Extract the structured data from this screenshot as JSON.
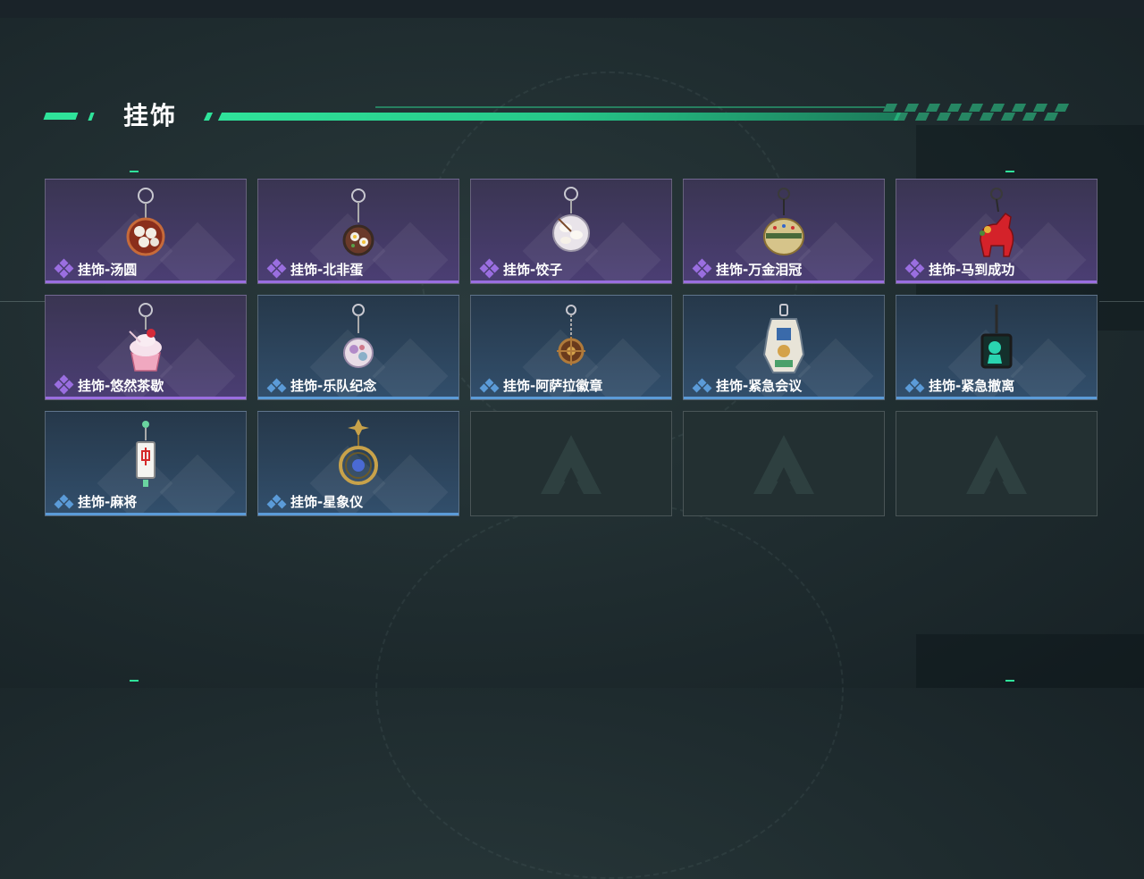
{
  "section": {
    "title": "挂饰"
  },
  "colors": {
    "accent_green": "#2fe39a",
    "rarity_purple": "#9a6ee0",
    "rarity_blue": "#5b9bd8"
  },
  "items": [
    {
      "name": "挂饰-汤圆",
      "rarity": "purple",
      "icon": "tangyuan-bowl-charm"
    },
    {
      "name": "挂饰-北非蛋",
      "rarity": "purple",
      "icon": "shakshuka-pan-charm"
    },
    {
      "name": "挂饰-饺子",
      "rarity": "purple",
      "icon": "dumplings-plate-charm"
    },
    {
      "name": "挂饰-万金泪冠",
      "rarity": "purple",
      "icon": "jeweled-crown-charm"
    },
    {
      "name": "挂饰-马到成功",
      "rarity": "purple",
      "icon": "red-horse-charm"
    },
    {
      "name": "挂饰-悠然茶歇",
      "rarity": "purple",
      "icon": "cupcake-charm"
    },
    {
      "name": "挂饰-乐队纪念",
      "rarity": "blue",
      "icon": "band-badge-charm"
    },
    {
      "name": "挂饰-阿萨拉徽章",
      "rarity": "blue",
      "icon": "asara-emblem-charm"
    },
    {
      "name": "挂饰-紧急会议",
      "rarity": "blue",
      "icon": "emergency-meeting-charm"
    },
    {
      "name": "挂饰-紧急撤离",
      "rarity": "blue",
      "icon": "emergency-exit-charm"
    },
    {
      "name": "挂饰-麻将",
      "rarity": "blue",
      "icon": "mahjong-tile-charm"
    },
    {
      "name": "挂饰-星象仪",
      "rarity": "blue",
      "icon": "astrolabe-charm"
    }
  ],
  "empty_slots": 3
}
